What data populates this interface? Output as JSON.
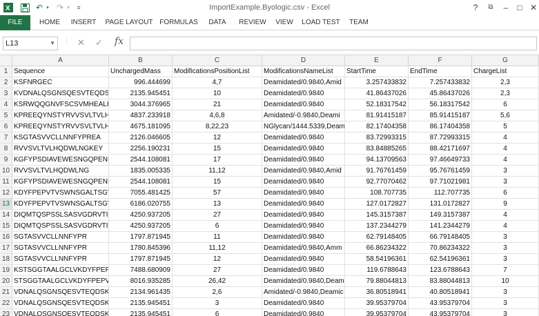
{
  "app": {
    "window_title": "ImportExample.Byologic.csv - Excel",
    "help_label": "?",
    "quick_access": {
      "undo_arrow": "↶",
      "redo_arrow": "↷",
      "customize": "≡"
    },
    "window_controls": {
      "restore": "⧉",
      "minimize": "–",
      "maximize": "□",
      "close": "✕"
    },
    "accent_color": "#217346"
  },
  "ribbon": {
    "tabs": [
      "FILE",
      "HOME",
      "INSERT",
      "PAGE LAYOUT",
      "FORMULAS",
      "DATA",
      "REVIEW",
      "VIEW",
      "LOAD TEST",
      "TEAM"
    ]
  },
  "formula_bar": {
    "name_box": "L13",
    "formula": "",
    "icons": {
      "cancel": "✕",
      "enter": "✓",
      "function": "fx"
    }
  },
  "sheet": {
    "columns": [
      "A",
      "B",
      "C",
      "D",
      "E",
      "F",
      "G"
    ],
    "selected_row": "13",
    "rows": [
      [
        "1",
        "Sequence",
        "UnchargedMass",
        "ModificationsPositionList",
        "ModificationsNameList",
        "StartTime",
        "EndTime",
        "ChargeList"
      ],
      [
        "2",
        "KSFNRGEC",
        "996.444699",
        "4,7",
        "Deamidated/0.9840,Amid",
        "3.257433832",
        "7.257433832",
        "2,3"
      ],
      [
        "3",
        "KVDNALQSGNSQESVTEQDS",
        "2135.945451",
        "10",
        "Deamidated/0.9840",
        "41.86437026",
        "45.86437026",
        "2,3"
      ],
      [
        "4",
        "KSRWQQGNVFSCSVMHEALHN",
        "3044.376965",
        "21",
        "Deamidated/0.9840",
        "52.18317542",
        "56.18317542",
        "6"
      ],
      [
        "5",
        "KPREEQYNSTYRVVSVLTVLHQD",
        "4837.233918",
        "4,6,8",
        "Amidated/-0.9840,Deami",
        "81.91415187",
        "85.91415187",
        "5,6"
      ],
      [
        "6",
        "KPREEQYNSTYRVVSVLTVLHQD",
        "4675.181095",
        "8,22,23",
        "NGlycan/1444.5339,Deam",
        "82.17404358",
        "86.17404358",
        "5"
      ],
      [
        "7",
        "KSGTASVVCLLNNFYPREA",
        "2126.046605",
        "12",
        "Deamidated/0.9840",
        "83.72993315",
        "87.72993315",
        "4"
      ],
      [
        "8",
        "RVVSVLTVLHQDWLNGKEY",
        "2256.190231",
        "15",
        "Deamidated/0.9840",
        "83.84885265",
        "88.42171697",
        "4"
      ],
      [
        "9",
        "KGFYPSDIAVEWESNGQPENNY",
        "2544.108081",
        "17",
        "Deamidated/0.9840",
        "94.13709563",
        "97.46649733",
        "4"
      ],
      [
        "10",
        "RVVSVLTVLHQDWLNG",
        "1835.005335",
        "11,12",
        "Deamidated/0.9840,Amid",
        "91.76761459",
        "95.76761459",
        "3"
      ],
      [
        "11",
        "KGFYPSDIAVEWESNGQPENNY",
        "2544.108081",
        "15",
        "Deamidated/0.9840",
        "92.77070462",
        "97.71021981",
        "3"
      ],
      [
        "12",
        "KDYFPEPVTVSWNSGALTSGVH",
        "7055.481425",
        "57",
        "Deamidated/0.9840",
        "108.707735",
        "112.707735",
        "6"
      ],
      [
        "13",
        "KDYFPEPVTVSWNSGALTSGVH",
        "6186.020755",
        "13",
        "Deamidated/0.9840",
        "127.0172827",
        "131.0172827",
        "9"
      ],
      [
        "14",
        "DIQMTQSPSSLSASVGDRVTITC",
        "4250.937205",
        "27",
        "Deamidated/0.9840",
        "145.3157387",
        "149.3157387",
        "4"
      ],
      [
        "15",
        "DIQMTQSPSSLSASVGDRVTITC",
        "4250.937205",
        "6",
        "Deamidated/0.9840",
        "137.2344279",
        "141.2344279",
        "4"
      ],
      [
        "16",
        "SGTASVVCLLNNFYPR",
        "1797.871945",
        "11",
        "Deamidated/0.9840",
        "62.79148405",
        "66.79148405",
        "3"
      ],
      [
        "17",
        "SGTASVVCLLNNFYPR",
        "1780.845396",
        "11,12",
        "Deamidated/0.9840,Amm",
        "66.86234322",
        "70.86234322",
        "3"
      ],
      [
        "18",
        "SGTASVVCLLNNFYPR",
        "1797.871945",
        "12",
        "Deamidated/0.9840",
        "58.54196361",
        "62.54196361",
        "3"
      ],
      [
        "19",
        "KSTSGGTAALGCLVKDYFPEPVT",
        "7488.680909",
        "27",
        "Deamidated/0.9840",
        "119.6788643",
        "123.6788643",
        "7"
      ],
      [
        "20",
        "STSGGTAALGCLVKDYFPEPVTV",
        "8016.935285",
        "26,42",
        "Deamidated/0.9840,Deam",
        "79.88044813",
        "83.88044813",
        "10"
      ],
      [
        "21",
        "VDNALQSGNSQESVTEQDSK",
        "2134.961435",
        "2,6",
        "Amidated/-0.9840,Deamic",
        "36.80518941",
        "40.80518941",
        "3"
      ],
      [
        "22",
        "VDNALQSGNSQESVTEQDSK",
        "2135.945451",
        "3",
        "Deamidated/0.9840",
        "39.95379704",
        "43.95379704",
        "3"
      ],
      [
        "23",
        "VDNALQSGNSQESVTEQDSK",
        "2135.945451",
        "6",
        "Deamidated/0.9840",
        "39.95379704",
        "43.95379704",
        "3"
      ],
      [
        "24",
        "VDNALQSGNSQESVTEQDSK",
        "2135.945451",
        "9",
        "Deamidated/0.9840",
        "36.83448115",
        "40.83448115",
        "3"
      ]
    ]
  }
}
